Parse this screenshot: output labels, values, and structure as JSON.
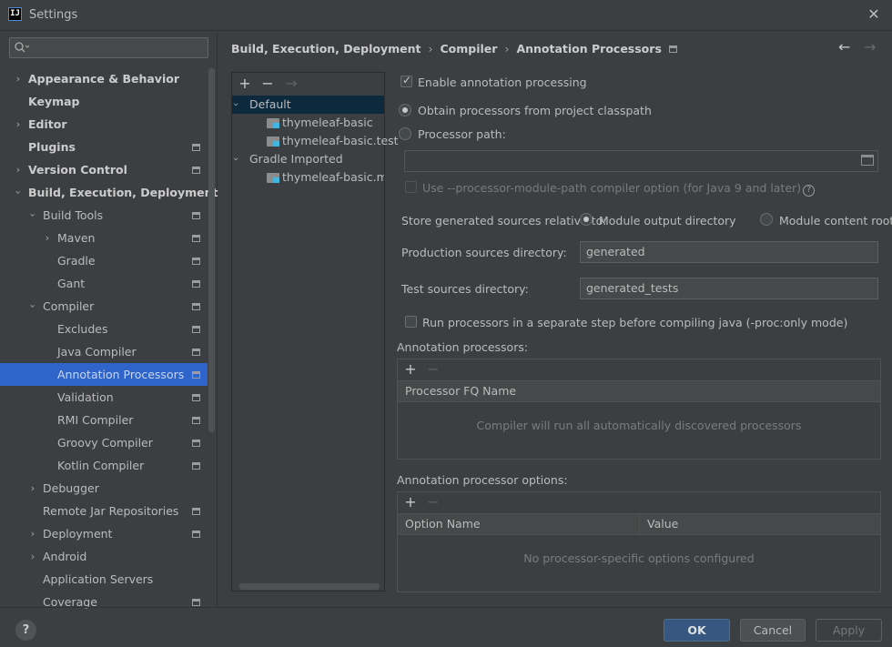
{
  "window": {
    "title": "Settings",
    "app_icon": "IJ",
    "close": "✕"
  },
  "search": {
    "placeholder": "",
    "icon": "search-icon"
  },
  "sidebar": {
    "items": [
      {
        "label": "Appearance & Behavior"
      },
      {
        "label": "Keymap"
      },
      {
        "label": "Editor"
      },
      {
        "label": "Plugins"
      },
      {
        "label": "Version Control"
      },
      {
        "label": "Build, Execution, Deployment"
      },
      {
        "label": "Build Tools"
      },
      {
        "label": "Maven"
      },
      {
        "label": "Gradle"
      },
      {
        "label": "Gant"
      },
      {
        "label": "Compiler"
      },
      {
        "label": "Excludes"
      },
      {
        "label": "Java Compiler"
      },
      {
        "label": "Annotation Processors"
      },
      {
        "label": "Validation"
      },
      {
        "label": "RMI Compiler"
      },
      {
        "label": "Groovy Compiler"
      },
      {
        "label": "Kotlin Compiler"
      },
      {
        "label": "Debugger"
      },
      {
        "label": "Remote Jar Repositories"
      },
      {
        "label": "Deployment"
      },
      {
        "label": "Android"
      },
      {
        "label": "Application Servers"
      },
      {
        "label": "Coverage"
      }
    ]
  },
  "breadcrumb": {
    "items": [
      "Build, Execution, Deployment",
      "Compiler",
      "Annotation Processors"
    ],
    "separator": "›"
  },
  "nav": {
    "back": "←",
    "forward": "→"
  },
  "profiles": {
    "toolbar": {
      "add": "+",
      "remove": "−",
      "move": "→"
    },
    "items": [
      {
        "label": "Default"
      },
      {
        "label": "thymeleaf-basic"
      },
      {
        "label": "thymeleaf-basic.test"
      },
      {
        "label": "Gradle Imported"
      },
      {
        "label": "thymeleaf-basic.main"
      }
    ]
  },
  "settings": {
    "enable_annotation_processing": {
      "label": "Enable annotation processing",
      "checked": true
    },
    "obtain_from_classpath": {
      "label": "Obtain processors from project classpath",
      "selected": true
    },
    "processor_path": {
      "label": "Processor path:",
      "selected": false,
      "value": ""
    },
    "module_path_option": {
      "label": "Use --processor-module-path compiler option (for Java 9 and later)",
      "checked": false
    },
    "store_generated_label": "Store generated sources relative to:",
    "module_output_directory": {
      "label": "Module output directory",
      "selected": true
    },
    "module_content_root": {
      "label": "Module content root",
      "selected": false
    },
    "production_sources": {
      "label": "Production sources directory:",
      "value": "generated"
    },
    "test_sources": {
      "label": "Test sources directory:",
      "value": "generated_tests"
    },
    "run_separate_step": {
      "label": "Run processors in a separate step before compiling java (-proc:only mode)",
      "checked": false
    }
  },
  "annotation_processors": {
    "title": "Annotation processors:",
    "add": "+",
    "remove": "−",
    "columns": [
      "Processor FQ Name"
    ],
    "empty_text": "Compiler will run all automatically discovered processors"
  },
  "processor_options": {
    "title": "Annotation processor options:",
    "add": "+",
    "remove": "−",
    "columns": [
      "Option Name",
      "Value"
    ],
    "empty_text": "No processor-specific options configured"
  },
  "buttons": {
    "help": "?",
    "ok": "OK",
    "cancel": "Cancel",
    "apply": "Apply"
  },
  "colors": {
    "background": "#3c3f41",
    "selection": "#2f65ca",
    "ok_button": "#365880"
  }
}
